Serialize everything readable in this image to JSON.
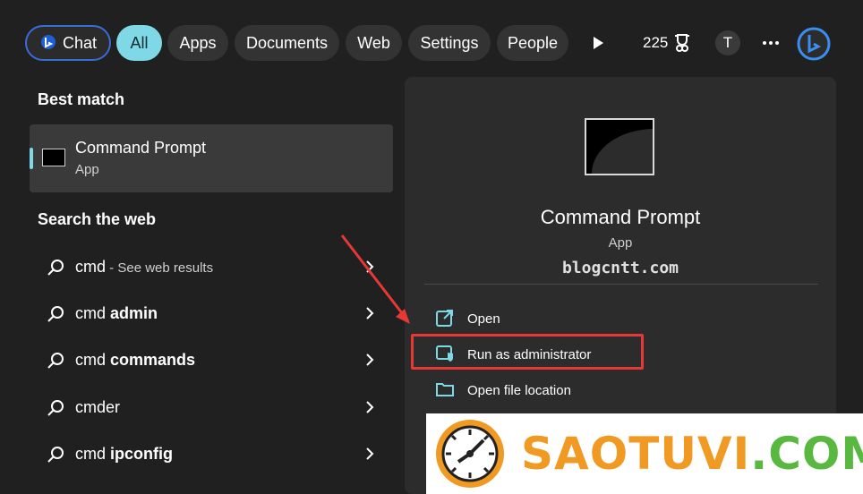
{
  "topbar": {
    "tabs": [
      {
        "label": "Chat"
      },
      {
        "label": "All"
      },
      {
        "label": "Apps"
      },
      {
        "label": "Documents"
      },
      {
        "label": "Web"
      },
      {
        "label": "Settings"
      },
      {
        "label": "People"
      }
    ],
    "points": "225",
    "avatar_letter": "T"
  },
  "best_match": {
    "heading": "Best match",
    "title": "Command Prompt",
    "subtitle": "App"
  },
  "search_web": {
    "heading": "Search the web",
    "items": [
      {
        "query": "cmd",
        "bold": "",
        "hint": " - See web results"
      },
      {
        "query": "cmd ",
        "bold": "admin",
        "hint": ""
      },
      {
        "query": "cmd ",
        "bold": "commands",
        "hint": ""
      },
      {
        "query": "cmder",
        "bold": "",
        "hint": ""
      },
      {
        "query": "cmd ",
        "bold": "ipconfig",
        "hint": ""
      }
    ]
  },
  "details": {
    "title": "Command Prompt",
    "subtitle": "App",
    "watermark": "blogcntt.com",
    "actions": [
      {
        "label": "Open"
      },
      {
        "label": "Run as administrator"
      },
      {
        "label": "Open file location"
      }
    ]
  },
  "banner": {
    "brand_a": "SAOTUVI",
    "brand_b": ".COM"
  },
  "colors": {
    "accent": "#7fd8e6",
    "highlight": "#e53935",
    "brand_orange": "#f19a23",
    "brand_green": "#59b83f"
  }
}
